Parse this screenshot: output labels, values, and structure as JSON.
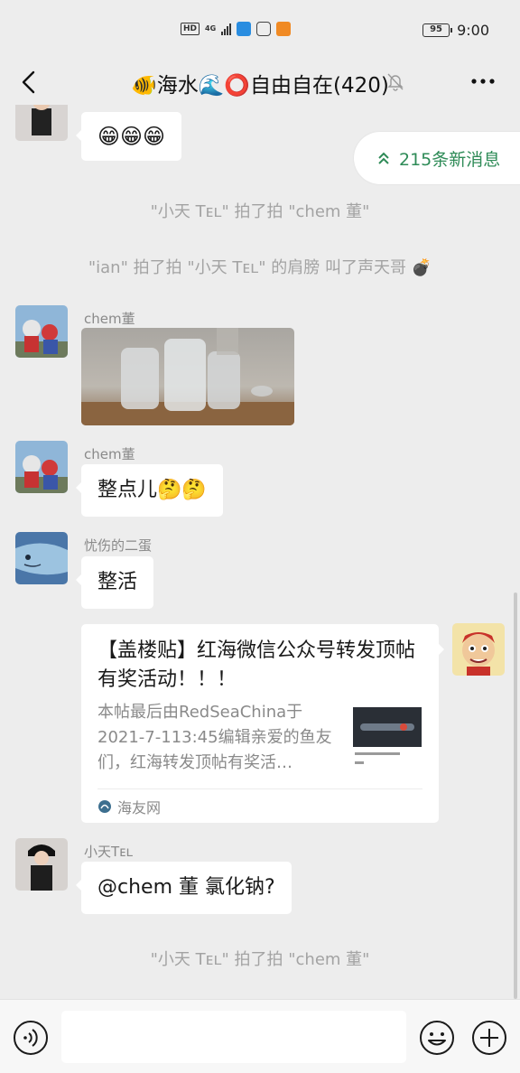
{
  "status_bar": {
    "network": "HD",
    "signal_type": "4G",
    "battery": "95",
    "time": "9:00"
  },
  "nav": {
    "title": "🐠海水🌊⭕自由自在(420)",
    "back_icon": "back-chevron-icon",
    "mute_icon": "bell-muted-icon",
    "more_icon": "more-dots-icon"
  },
  "new_messages": {
    "label": "215条新消息"
  },
  "messages": [
    {
      "type": "emoji",
      "text": "😁😁😁"
    },
    {
      "type": "system",
      "text": "\"小天 Tᴇʟ\" 拍了拍 \"chem 董\""
    },
    {
      "type": "system",
      "text": "\"ian\" 拍了拍 \"小天 Tᴇʟ\" 的肩膀 叫了声天哥 💣"
    },
    {
      "type": "image",
      "sender": "chem董"
    },
    {
      "type": "text",
      "sender": "chem董",
      "text": "整点儿🤔🤔"
    },
    {
      "type": "text",
      "sender": "忧伤的二蛋",
      "text": "整活"
    },
    {
      "type": "card",
      "title": "【盖楼贴】红海微信公众号转发顶帖有奖活动！！！",
      "desc": "本帖最后由RedSeaChina于2021-7-113:45编辑亲爱的鱼友们，红海转发顶帖有奖活…",
      "source": "海友网"
    },
    {
      "type": "text",
      "sender": "小天Tᴇʟ",
      "text": "@chem 董  氯化钠?"
    },
    {
      "type": "system",
      "text": "\"小天 Tᴇʟ\" 拍了拍 \"chem 董\""
    }
  ],
  "input_bar": {
    "value": "",
    "voice_icon": "voice-icon",
    "emoji_icon": "emoji-icon",
    "plus_icon": "plus-icon"
  },
  "colors": {
    "background": "#ededed",
    "bubble": "#ffffff",
    "accent_green": "#2e8b57",
    "system_text": "#a3a3a3"
  }
}
